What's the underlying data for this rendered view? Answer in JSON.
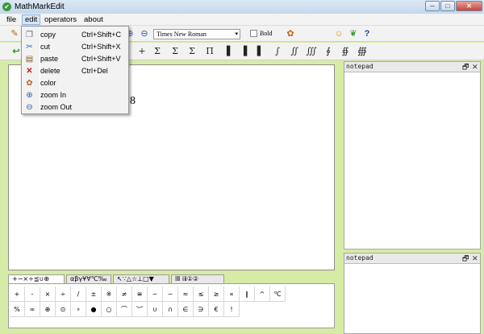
{
  "window": {
    "title": "MathMarkEdit",
    "minimize": "─",
    "maximize": "□",
    "close": "✕"
  },
  "menu": {
    "file": "file",
    "edit": "edit",
    "operators": "operators",
    "about": "about"
  },
  "toolbar": {
    "font": "Times New Roman",
    "font_arrow": "▾",
    "bold_label": "Bold",
    "symbols": [
      "+",
      "Σ",
      "Σ",
      "Σ",
      "Π",
      "▐",
      "▐",
      "▌",
      "∫",
      "∬",
      "∭",
      "∮",
      "∯",
      "∰"
    ]
  },
  "edit_menu": {
    "items": [
      {
        "icon": "copy-icon",
        "label": "copy",
        "shortcut": "Ctrl+Shift+C"
      },
      {
        "icon": "cut-icon",
        "label": "cut",
        "shortcut": "Ctrl+Shift+X"
      },
      {
        "icon": "paste-icon",
        "label": "paste",
        "shortcut": "Ctrl+Shift+V"
      },
      {
        "icon": "delete-icon",
        "label": "delete",
        "shortcut": "Ctrl+Del"
      },
      {
        "icon": "color-icon",
        "label": "color",
        "shortcut": ""
      },
      {
        "icon": "zoom-in-icon",
        "label": "zoom In",
        "shortcut": ""
      },
      {
        "icon": "zoom-out-icon",
        "label": "zoom Out",
        "shortcut": ""
      }
    ]
  },
  "editor": {
    "content": "8"
  },
  "notepad": {
    "top_title": "notepad",
    "bottom_title": "notepad",
    "restore": "🗗",
    "close": "✕"
  },
  "symbol_tabs": [
    "+−×÷≦∪⊕",
    "αβγ¥∀℃‰",
    "↖∵△☆⊥□▼",
    "ⅠⅡ ⅰⅱ①②"
  ],
  "symbol_rows": [
    [
      "+",
      "-",
      "×",
      "÷",
      "/",
      "±",
      "※",
      "≠",
      "≅",
      "~",
      "~",
      "≈",
      "≤",
      "≥",
      "∝",
      "∥",
      "^",
      "℃"
    ],
    [
      "%",
      "∞",
      "⊕",
      "⊙",
      "∘",
      "●",
      "○",
      "⌒",
      "︶",
      "∪",
      "∩",
      "∈",
      "∋",
      "€",
      "!"
    ]
  ]
}
